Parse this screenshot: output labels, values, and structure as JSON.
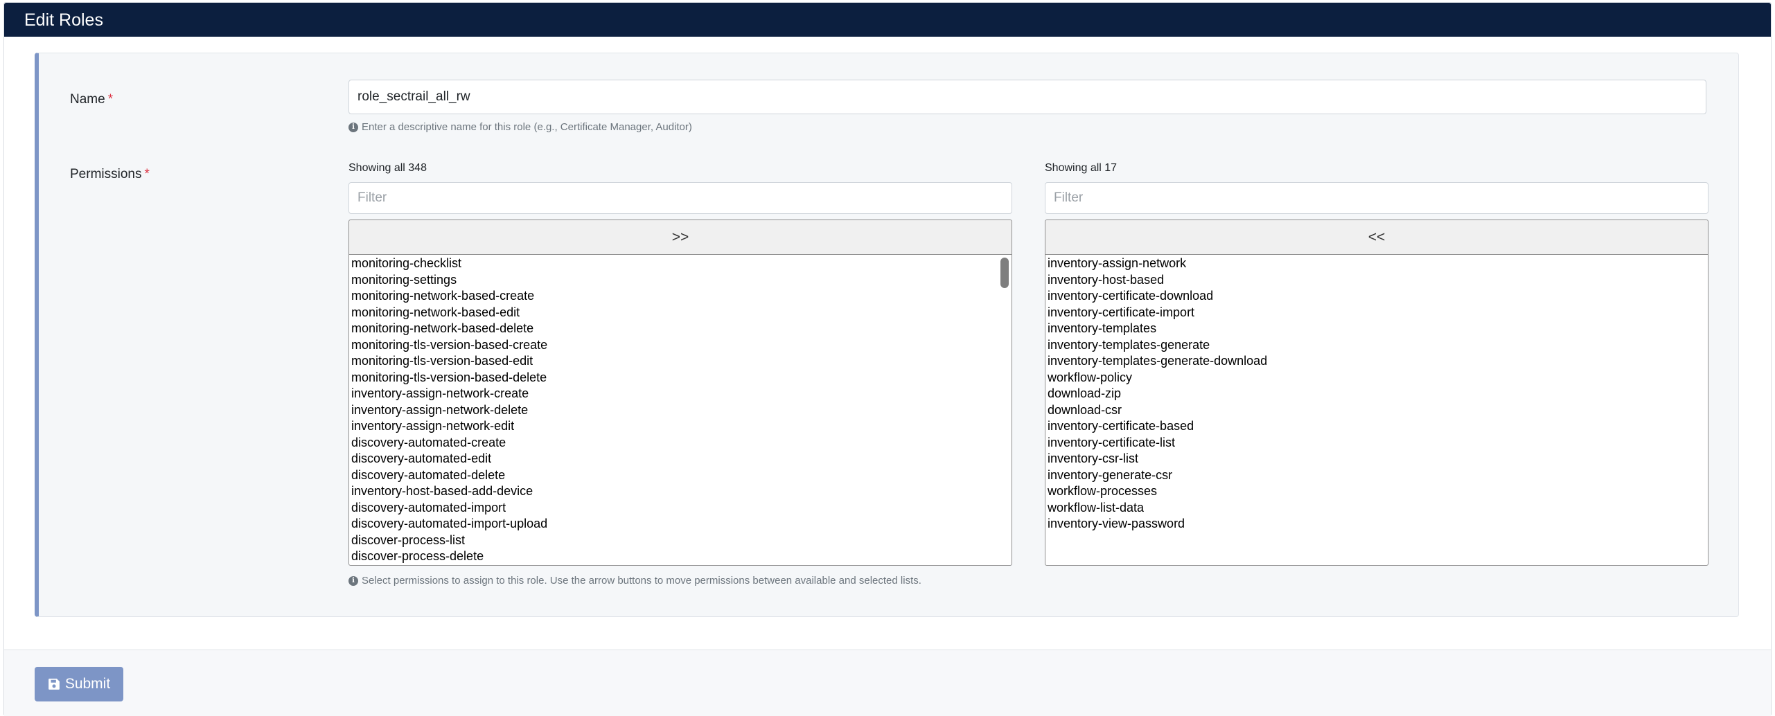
{
  "header": {
    "title": "Edit Roles"
  },
  "form": {
    "name_label": "Name",
    "required_mark": "*",
    "name_value": "role_sectrail_all_rw",
    "name_help": "Enter a descriptive name for this role (e.g., Certificate Manager, Auditor)",
    "permissions_label": "Permissions",
    "permissions_help": "Select permissions to assign to this role. Use the arrow buttons to move permissions between available and selected lists."
  },
  "available": {
    "showing": "Showing all 348",
    "filter_placeholder": "Filter",
    "move_label": ">>",
    "items": [
      "monitoring-checklist",
      "monitoring-settings",
      "monitoring-network-based-create",
      "monitoring-network-based-edit",
      "monitoring-network-based-delete",
      "monitoring-tls-version-based-create",
      "monitoring-tls-version-based-edit",
      "monitoring-tls-version-based-delete",
      "inventory-assign-network-create",
      "inventory-assign-network-delete",
      "inventory-assign-network-edit",
      "discovery-automated-create",
      "discovery-automated-edit",
      "discovery-automated-delete",
      "inventory-host-based-add-device",
      "discovery-automated-import",
      "discovery-automated-import-upload",
      "discover-process-list",
      "discover-process-delete"
    ]
  },
  "selected": {
    "showing": "Showing all 17",
    "filter_placeholder": "Filter",
    "move_label": "<<",
    "items": [
      "inventory-assign-network",
      "inventory-host-based",
      "inventory-certificate-download",
      "inventory-certificate-import",
      "inventory-templates",
      "inventory-templates-generate",
      "inventory-templates-generate-download",
      "workflow-policy",
      "download-zip",
      "download-csr",
      "inventory-certificate-based",
      "inventory-certificate-list",
      "inventory-csr-list",
      "inventory-generate-csr",
      "workflow-processes",
      "workflow-list-data",
      "inventory-view-password"
    ]
  },
  "footer": {
    "submit_label": "Submit",
    "submit_icon": "save-icon"
  },
  "colors": {
    "header_bg": "#0c1f3f",
    "accent": "#7d95c6",
    "required": "#dc3545"
  }
}
